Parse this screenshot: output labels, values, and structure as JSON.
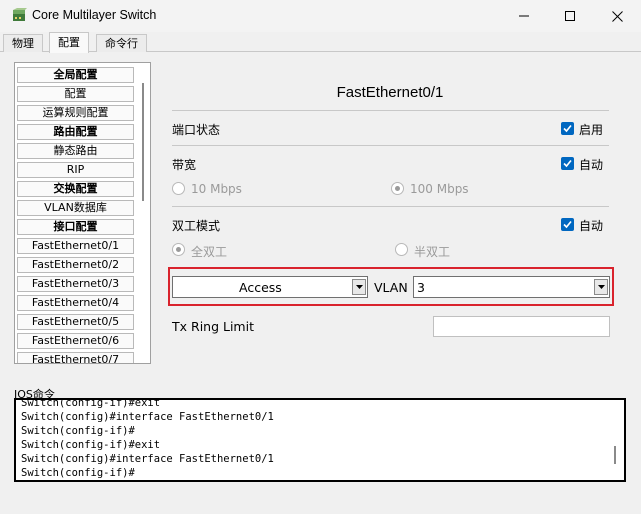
{
  "window": {
    "title": "Core Multilayer Switch",
    "icon": "switch-icon"
  },
  "tabs": [
    {
      "label": "物理",
      "active": false
    },
    {
      "label": "配置",
      "active": true
    },
    {
      "label": "命令行",
      "active": false
    }
  ],
  "sidebar": {
    "items": [
      {
        "label": "全局配置",
        "section": true
      },
      {
        "label": "配置",
        "section": false
      },
      {
        "label": "运算规则配置",
        "section": false
      },
      {
        "label": "路由配置",
        "section": true
      },
      {
        "label": "静态路由",
        "section": false
      },
      {
        "label": "RIP",
        "section": false
      },
      {
        "label": "交换配置",
        "section": true
      },
      {
        "label": "VLAN数据库",
        "section": false
      },
      {
        "label": "接口配置",
        "section": true
      },
      {
        "label": "FastEthernet0/1",
        "section": false
      },
      {
        "label": "FastEthernet0/2",
        "section": false
      },
      {
        "label": "FastEthernet0/3",
        "section": false
      },
      {
        "label": "FastEthernet0/4",
        "section": false
      },
      {
        "label": "FastEthernet0/5",
        "section": false
      },
      {
        "label": "FastEthernet0/6",
        "section": false
      },
      {
        "label": "FastEthernet0/7",
        "section": false
      }
    ]
  },
  "main": {
    "title": "FastEthernet0/1",
    "port_status": {
      "label": "端口状态",
      "checkbox_label": "启用",
      "checked": true
    },
    "bandwidth": {
      "label": "带宽",
      "auto_label": "自动",
      "auto_checked": true,
      "options": [
        {
          "label": "10 Mbps",
          "selected": false
        },
        {
          "label": "100 Mbps",
          "selected": true
        }
      ]
    },
    "duplex": {
      "label": "双工模式",
      "auto_label": "自动",
      "auto_checked": true,
      "options": [
        {
          "label": "全双工",
          "selected": true
        },
        {
          "label": "半双工",
          "selected": false
        }
      ]
    },
    "mode_select": {
      "value": "Access"
    },
    "vlan": {
      "label": "VLAN",
      "value": "3"
    },
    "tx_ring_limit": {
      "label": "Tx Ring Limit",
      "value": ""
    }
  },
  "ios": {
    "label": "IOS命令",
    "lines": [
      "Switch(config-if)#exit",
      "Switch(config)#interface FastEthernet0/1",
      "Switch(config-if)#",
      "Switch(config-if)#exit",
      "Switch(config)#interface FastEthernet0/1",
      "Switch(config-if)#"
    ]
  },
  "colors": {
    "accent": "#0067c0",
    "highlight": "#d9232d"
  }
}
